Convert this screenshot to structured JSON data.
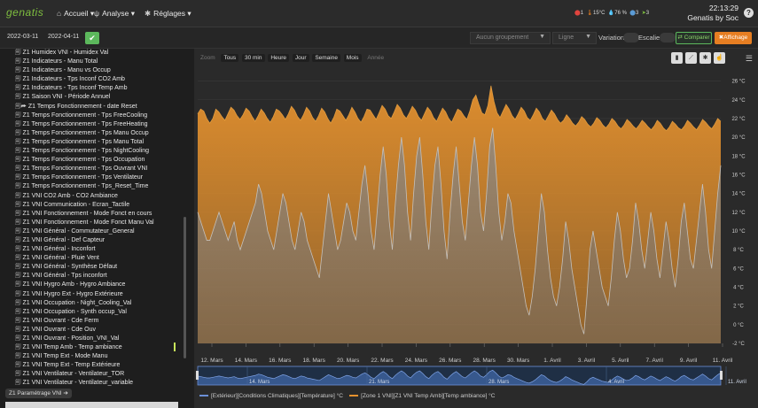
{
  "app": {
    "logo": "genatis",
    "menu": [
      {
        "icon": "home-icon",
        "glyph": "⌂",
        "label": "Accueil"
      },
      {
        "icon": "analysis-icon",
        "glyph": "ψ",
        "label": "Analyse"
      },
      {
        "icon": "gear-icon",
        "glyph": "✱",
        "label": "Réglages"
      }
    ],
    "status": {
      "alarms": "1",
      "temperature": "15°C",
      "humidity": "76 %",
      "value3": "3",
      "value4": "3"
    },
    "clock": {
      "time": "22:13:29",
      "user": "Genatis by Soc"
    },
    "help": "?"
  },
  "toolbar": {
    "date_start": "2022-03-11",
    "date_end": "2022-04-11",
    "grouping_placeholder": "Aucun groupement",
    "chart_type": "Ligne",
    "variation_label": "Variation",
    "stairs_label": "Escalier",
    "compare_label": "Comparer",
    "display_label": "Affichage"
  },
  "sidebar": {
    "items": [
      "Z1 Humidex VNI - Humidex Val",
      "Z1 Indicateurs - Manu Total",
      "Z1 Indicateurs - Manu vs Occup",
      "Z1 Indicateurs - Tps Inconf CO2 Amb",
      "Z1 Indicateurs - Tps Inconf Temp Amb",
      "Z1 Saison VNI - Période Annuel",
      "Z1 Temps Fonctionnement - date Reset",
      "Z1 Temps Fonctionnement - Tps FreeCooling",
      "Z1 Temps Fonctionnement - Tps FreeHeating",
      "Z1 Temps Fonctionnement - Tps Manu Occup",
      "Z1 Temps Fonctionnement - Tps Manu Total",
      "Z1 Temps Fonctionnement - Tps NightCooling",
      "Z1 Temps Fonctionnement - Tps Occupation",
      "Z1 Temps Fonctionnement - Tps Ouvrant VNI",
      "Z1 Temps Fonctionnement - Tps Ventilateur",
      "Z1 Temps Fonctionnement - Tps_Reset_Time",
      "Z1 VNI CO2 Amb - CO2 Ambiance",
      "Z1 VNI Communication - Ecran_Tactile",
      "Z1 VNI Fonctionnement - Mode Fonct en cours",
      "Z1 VNI Fonctionnement - Mode Fonct Manu Val",
      "Z1 VNI Général - Commutateur_General",
      "Z1 VNI Général - Def Capteur",
      "Z1 VNI Général - Inconfort",
      "Z1 VNI Général - Pluie Vent",
      "Z1 VNI Général - Synthèse Défaut",
      "Z1 VNI Général - Tps inconfort",
      "Z1 VNI Hygro Amb - Hygro Ambiance",
      "Z1 VNI Hygro Ext - Hygro Extérieure",
      "Z1 VNI Occupation - Night_Cooling_Val",
      "Z1 VNI Occupation - Synth occup_Val",
      "Z1 VNI Ouvrant - Cde Ferm",
      "Z1 VNI Ouvrant - Cde Ouv",
      "Z1 VNI Ouvrant - Position_VNI_Val",
      "Z1 VNI Temp Amb - Temp ambiance",
      "Z1 VNI Temp Ext - Mode Manu",
      "Z1 VNI Temp Ext - Temp Extérieure",
      "Z1 VNI Ventilateur - Ventilateur_TOR",
      "Z1 VNI Ventilateur - Ventilateur_variable"
    ],
    "param_tag": "Z1 Paramétrage VNI"
  },
  "chart": {
    "zoom_label": "Zoom",
    "zoom_buttons": [
      "Tous",
      "30 min",
      "Heure",
      "Jour",
      "Semaine",
      "Mois",
      "Année"
    ],
    "tools": [
      "▮",
      "⟋",
      "✱",
      "☝"
    ]
  },
  "chart_data": {
    "type": "area",
    "x_dates": [
      "12. Mars",
      "14. Mars",
      "16. Mars",
      "18. Mars",
      "20. Mars",
      "22. Mars",
      "24. Mars",
      "26. Mars",
      "28. Mars",
      "30. Mars",
      "1. Avril",
      "3. Avril",
      "5. Avril",
      "7. Avril",
      "9. Avril",
      "11. Avril"
    ],
    "navigator_labels": [
      "14. Mars",
      "21. Mars",
      "28. Mars",
      "4. Avril",
      "11. Avril"
    ],
    "y_ticks": [
      "26 °C",
      "24 °C",
      "22 °C",
      "20 °C",
      "18 °C",
      "16 °C",
      "14 °C",
      "12 °C",
      "10 °C",
      "8 °C",
      "6 °C",
      "4 °C",
      "2 °C",
      "0 °C",
      "-2 °C"
    ],
    "ylim": [
      -2,
      27
    ],
    "series": [
      {
        "name": "[Extérieur][Conditions Climatiques][Température] °C",
        "color": "#6b8fd6",
        "values": [
          12,
          11,
          10,
          9,
          9,
          10,
          11,
          12,
          11,
          10,
          9,
          10,
          11,
          9,
          8,
          9,
          10,
          11,
          12,
          13,
          15,
          14,
          12,
          10,
          9,
          8,
          10,
          12,
          14,
          13,
          11,
          9,
          8,
          10,
          12,
          11,
          9,
          8,
          7,
          6,
          5,
          8,
          11,
          14,
          12,
          10,
          8,
          9,
          11,
          13,
          12,
          10,
          9,
          12,
          15,
          17,
          14,
          10,
          8,
          12,
          16,
          19,
          16,
          11,
          8,
          13,
          17,
          20,
          17,
          12,
          9,
          14,
          18,
          20,
          16,
          11,
          8,
          13,
          17,
          19,
          15,
          10,
          7,
          12,
          16,
          19,
          15,
          11,
          9,
          13,
          17,
          20,
          17,
          12,
          10,
          14,
          19,
          21,
          17,
          12,
          9,
          11,
          14,
          13,
          10,
          8,
          6,
          4,
          2,
          1,
          3,
          6,
          10,
          14,
          12,
          8,
          5,
          3,
          2,
          4,
          7,
          11,
          9,
          6,
          4,
          2,
          0,
          -1,
          3,
          8,
          10,
          8,
          6,
          4,
          3,
          2,
          5,
          9,
          12,
          10,
          7,
          5,
          6,
          9,
          13,
          11,
          8,
          6,
          9,
          12,
          10,
          7,
          5,
          8,
          11,
          9,
          6,
          4,
          7,
          11,
          13,
          10,
          7,
          6,
          9,
          12,
          15,
          12,
          8,
          6,
          10,
          14,
          17
        ]
      },
      {
        "name": "[Zone 1 VNI][Z1 VNI Temp Amb][Temp ambiance] °C",
        "color": "#e6922e",
        "values": [
          22.5,
          23,
          22.8,
          22,
          21.5,
          22,
          23,
          22.7,
          22.2,
          21.8,
          22.5,
          23.2,
          22.9,
          22.3,
          21.9,
          22.4,
          23.1,
          22.8,
          22.2,
          21.7,
          22.3,
          23,
          22.6,
          22,
          21.6,
          22.2,
          23,
          22.8,
          22.4,
          21.9,
          22.5,
          23.3,
          22.9,
          22.2,
          21.8,
          22.4,
          23.2,
          22.8,
          22.1,
          21.7,
          22.3,
          23.1,
          22.7,
          22,
          21.5,
          22.1,
          23,
          22.8,
          22.3,
          21.8,
          22.4,
          23.2,
          22.7,
          22,
          21.6,
          22.2,
          23,
          22.9,
          22.4,
          21.9,
          22.6,
          23.4,
          23,
          22.3,
          22,
          22.7,
          23.5,
          23.1,
          22.4,
          22,
          22.6,
          23.3,
          22.9,
          22.2,
          21.8,
          22.5,
          23.2,
          22.8,
          22.1,
          21.7,
          22.4,
          23.1,
          22.7,
          22,
          21.6,
          22.3,
          23,
          22.8,
          22.3,
          21.9,
          22.8,
          24,
          24.5,
          23.5,
          22.6,
          22.4,
          23.4,
          25.5,
          23.8,
          22.6,
          22.1,
          22.8,
          23.5,
          23,
          22.3,
          21.9,
          22.5,
          23.2,
          22.8,
          22.1,
          21.8,
          22.4,
          23.1,
          22.7,
          22,
          21.7,
          22.3,
          22.9,
          22.5,
          21.9,
          21.5,
          21.8,
          22.4,
          22,
          21.5,
          21.2,
          21.6,
          22.2,
          21.9,
          21.4,
          21.1,
          21.5,
          22.1,
          21.8,
          21.3,
          21,
          21.4,
          22,
          21.7,
          21.2,
          20.9,
          21.3,
          21.9,
          21.6,
          21.2,
          20.9,
          21.3,
          21.8,
          21.5,
          21.1,
          20.8,
          21.2,
          21.8,
          21.5,
          21,
          20.7,
          21.1,
          21.7,
          21.4,
          21,
          20.8,
          21.2,
          21.8,
          21.5,
          21.1,
          20.8,
          21.3,
          21.9,
          21.6,
          21.2,
          20.9,
          21.4,
          22,
          21.7
        ]
      }
    ]
  }
}
